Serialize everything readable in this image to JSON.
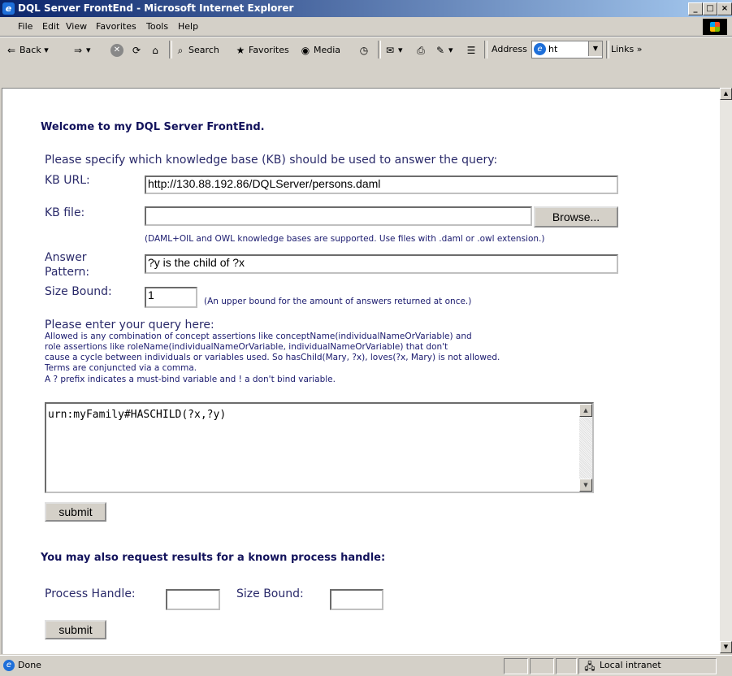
{
  "window": {
    "title": "DQL Server FrontEnd - Microsoft Internet Explorer",
    "controls": {
      "minimize": "_",
      "maximize": "□",
      "close": "×"
    }
  },
  "menu": [
    "File",
    "Edit",
    "View",
    "Favorites",
    "Tools",
    "Help"
  ],
  "toolbar": {
    "back": "Back",
    "search": "Search",
    "favorites": "Favorites",
    "media": "Media",
    "address_label": "Address",
    "address_value": "ht",
    "links": "Links"
  },
  "page": {
    "welcome": "Welcome to my DQL Server FrontEnd.",
    "kb_prompt": "Please specify which knowledge base (KB) should be used to answer the query:",
    "kb_url_label": "KB URL:",
    "kb_url_value": "http://130.88.192.86/DQLServer/persons.daml",
    "kb_file_label": "KB file:",
    "kb_file_value": "",
    "browse": "Browse...",
    "kb_support_note": "(DAML+OIL and OWL knowledge bases are supported. Use files with .daml or .owl extension.)",
    "answer_label_1": "Answer",
    "answer_label_2": "Pattern:",
    "answer_value": "?y is the child of ?x",
    "size_bound_label": "Size Bound:",
    "size_bound_value": "1",
    "size_bound_note": "(An upper bound for the amount of answers returned at once.)",
    "query_prompt": "Please enter your query here:",
    "query_help": [
      "Allowed is any combination of concept assertions like conceptName(individualNameOrVariable) and",
      "role assertions like roleName(individualNameOrVariable, individualNameOrVariable) that don't",
      "cause a cycle between individuals or variables used. So hasChild(Mary, ?x), loves(?x, Mary) is not allowed.",
      "Terms are conjuncted via a comma.",
      "A ? prefix indicates a must-bind variable and ! a don't bind variable."
    ],
    "query_value": "urn:myFamily#HASCHILD(?x,?y)",
    "submit": "submit",
    "handle_heading": "You may also request results for a known process handle:",
    "process_handle_label": "Process Handle:",
    "process_handle_value": "",
    "size_bound2_label": "Size Bound:",
    "size_bound2_value": "",
    "submit2": "submit"
  },
  "status": {
    "text": "Done",
    "zone": "Local intranet"
  }
}
